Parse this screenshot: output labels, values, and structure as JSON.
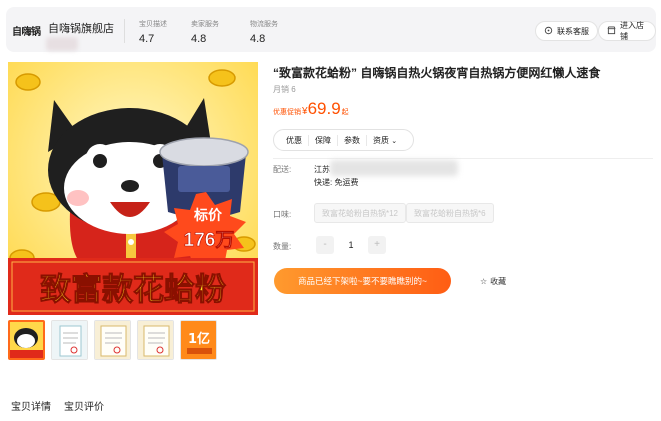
{
  "header": {
    "logo_text": "自嗨锅",
    "shop_name": "自嗨锅旗舰店",
    "scores": [
      {
        "label": "宝贝描述",
        "value": "4.7"
      },
      {
        "label": "卖家服务",
        "value": "4.8"
      },
      {
        "label": "物流服务",
        "value": "4.8"
      }
    ],
    "contact_label": "联系客服",
    "enter_shop_label": "进入店铺"
  },
  "product": {
    "title": "“致富款花蛤粉” 自嗨锅自热火锅夜宵自热锅方便网红懒人速食",
    "sold": "月销 6",
    "price_label": "优惠促销",
    "price_symbol": "¥",
    "price_value": "69.9",
    "price_unit": "起",
    "tabs": [
      "优惠",
      "保障",
      "参数",
      "资质"
    ],
    "shipping_label": "配送:",
    "ship_from": "江苏",
    "ship_fee": "快递: 免运费",
    "flavor_label": "口味:",
    "flavors": [
      "致富花蛤粉自热锅*12",
      "致富花蛤粉自热锅*6"
    ],
    "qty_label": "数量:",
    "qty_minus": "-",
    "qty_value": "1",
    "qty_plus": "+",
    "buy_label": "商品已经下架啦~要不要瞧瞧别的~",
    "favorite_label": "收藏"
  },
  "image": {
    "price_tag_top": "标价",
    "price_tag_bottom": "176万",
    "banner_text": "致富款花蛤粉",
    "thumb5_text": "1亿"
  },
  "detail_tabs": [
    "宝贝详情",
    "宝贝评价"
  ],
  "colors": {
    "accent": "#ff5000",
    "banner_red": "#e02a1a",
    "banner_yellow": "#ffe21f"
  }
}
